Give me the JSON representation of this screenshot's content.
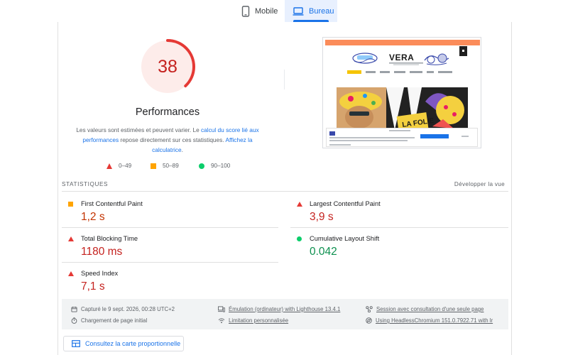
{
  "tabs": [
    {
      "label": "Mobile",
      "active": false
    },
    {
      "label": "Bureau",
      "active": true
    }
  ],
  "score": {
    "value": "38",
    "fraction": 0.38,
    "color": "#e53935",
    "title": "Performances",
    "desc_before": "Les valeurs sont estimées et peuvent varier. Le ",
    "desc_link1": "calcul du score lié aux performances",
    "desc_middle": " repose directement sur ces statistiques. ",
    "desc_link2": "Affichez la calculatrice",
    "desc_end": "."
  },
  "legend": [
    {
      "range": "0–49",
      "shape": "triangle",
      "color": "#e53935"
    },
    {
      "range": "50–89",
      "shape": "square",
      "color": "#ffa400"
    },
    {
      "range": "90–100",
      "shape": "circle",
      "color": "#0cce6b"
    }
  ],
  "preview": {
    "brand": "VERA"
  },
  "stats": {
    "label": "STATISTIQUES",
    "expand_label": "Développer la vue",
    "metrics": [
      {
        "name": "First Contentful Paint",
        "value": "1,2 s",
        "rating": "average"
      },
      {
        "name": "Largest Contentful Paint",
        "value": "3,9 s",
        "rating": "fail"
      },
      {
        "name": "Total Blocking Time",
        "value": "1180 ms",
        "rating": "fail"
      },
      {
        "name": "Cumulative Layout Shift",
        "value": "0.042",
        "rating": "pass"
      },
      {
        "name": "Speed Index",
        "value": "7,1 s",
        "rating": "fail"
      }
    ]
  },
  "info": {
    "captured": "Capturé le 9 sept. 2026, 00:28 UTC+2",
    "page_load": "Chargement de page initial",
    "emulation": "Émulation (ordinateur) with Lighthouse 13.4.1",
    "throttling": "Limitation personnalisée",
    "session": "Session avec consultation d'une seule page",
    "browser": "Using HeadlessChromium 151.0.7922.71 with lr"
  },
  "map_button": {
    "label": "Consultez la carte proportionnelle"
  }
}
